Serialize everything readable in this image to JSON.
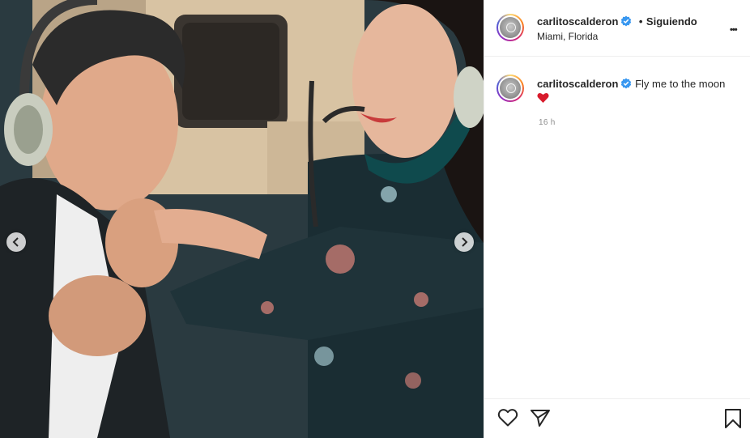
{
  "post": {
    "username": "carlitoscalderon",
    "follow_separator": "•",
    "follow_status": "Siguiendo",
    "location": "Miami, Florida",
    "caption_username": "carlitoscalderon",
    "caption_text": "Fly me to the moon",
    "timestamp": "16 h",
    "more_label": "•••"
  },
  "icons": {
    "verified": "verified-badge-icon",
    "heart_emoji": "red-heart-emoji",
    "like": "heart-outline-icon",
    "share": "paper-plane-icon",
    "save": "bookmark-icon",
    "prev": "chevron-left-icon",
    "next": "chevron-right-icon"
  },
  "colors": {
    "verified": "#3897f0",
    "heart": "#ed4956",
    "text": "#262626",
    "muted": "#8e8e8e"
  }
}
